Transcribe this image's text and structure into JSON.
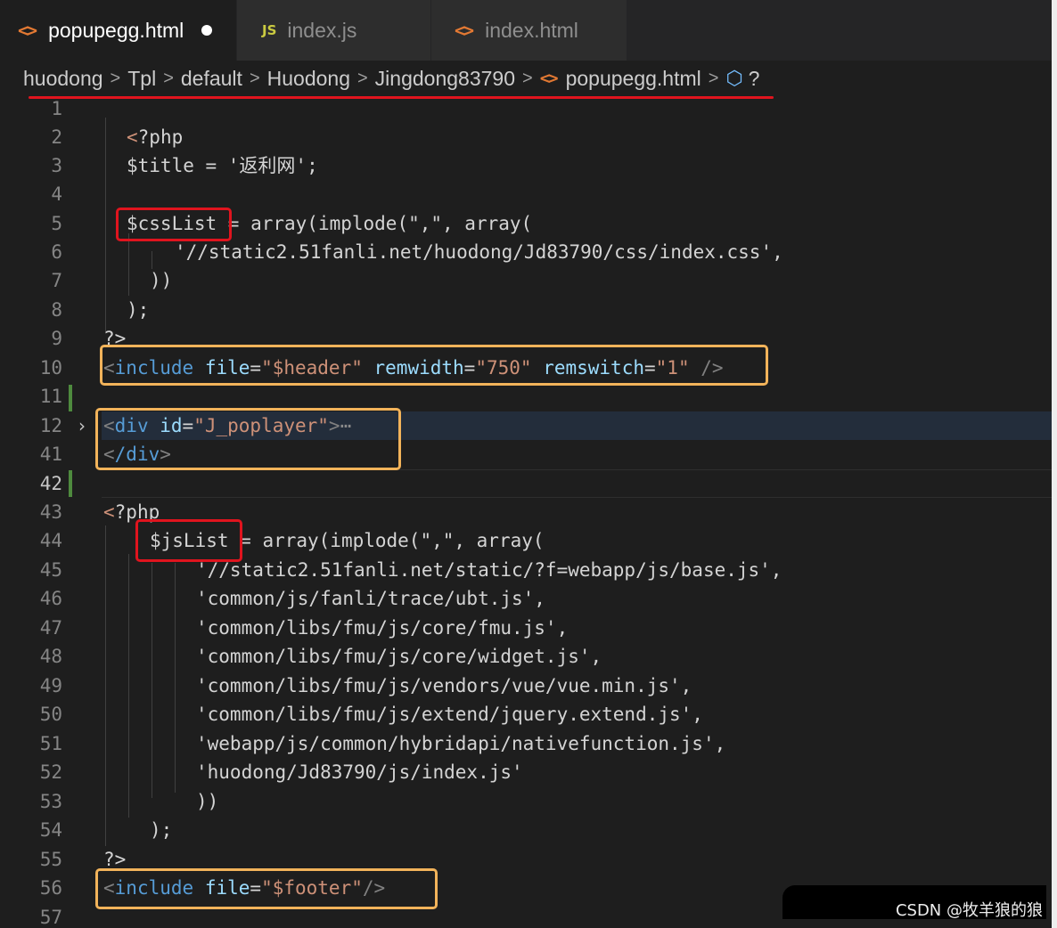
{
  "tabs": [
    {
      "label": "popupegg.html",
      "icon": "html-file-icon",
      "active": true,
      "modified": true
    },
    {
      "label": "index.js",
      "icon": "js-file-icon",
      "active": false,
      "modified": false
    },
    {
      "label": "index.html",
      "icon": "html-file-icon",
      "active": false,
      "modified": false
    }
  ],
  "breadcrumb": {
    "parts": [
      "huodong",
      "Tpl",
      "default",
      "Huodong",
      "Jingdong83790"
    ],
    "file": "popupegg.html",
    "symbol": "?"
  },
  "gutter": [
    "1",
    "2",
    "3",
    "4",
    "5",
    "6",
    "7",
    "8",
    "9",
    "10",
    "11",
    "12",
    "41",
    "42",
    "43",
    "44",
    "45",
    "46",
    "47",
    "48",
    "49",
    "50",
    "51",
    "52",
    "53",
    "54",
    "55",
    "56",
    "57"
  ],
  "code": {
    "php_open": "?php",
    "title_line": "$title = '返利网';",
    "css_var": "$cssList",
    "css_assign": " = array(implode(\",\", array(",
    "css_url": "'//static2.51fanli.net/huodong/Jd83790/css/index.css',",
    "close_paren2": "))",
    "close_semi": ");",
    "php_close": "?>",
    "include_open": "include",
    "attr_file": "file",
    "header_value": "\"$header\"",
    "attr_remwidth": "remwidth",
    "remwidth_value": "\"750\"",
    "attr_remswitch": "remswitch",
    "remswitch_value": "\"1\"",
    "self_close": "/>",
    "div_tag": "div",
    "attr_id": "id",
    "id_value": "\"J_poplayer\"",
    "fold_ellipsis": "⋯",
    "div_close": "/div",
    "js_var": "$jsList",
    "js_assign": " = array(implode(\",\", array(",
    "js_items": [
      "'//static2.51fanli.net/static/?f=webapp/js/base.js',",
      "'common/js/fanli/trace/ubt.js',",
      "'common/libs/fmu/js/core/fmu.js',",
      "'common/libs/fmu/js/core/widget.js',",
      "'common/libs/fmu/js/vendors/vue/vue.min.js',",
      "'common/libs/fmu/js/extend/jquery.extend.js',",
      "'webapp/js/common/hybridapi/nativefunction.js',",
      "'huodong/Jd83790/js/index.js'"
    ],
    "footer_value": "\"$footer\""
  },
  "watermark": "CSDN @牧羊狼的狼",
  "colors": {
    "annotation_red": "#e0141e",
    "annotation_orange": "#f2b35a",
    "html_icon": "#e37933",
    "js_icon": "#cbcb41"
  }
}
